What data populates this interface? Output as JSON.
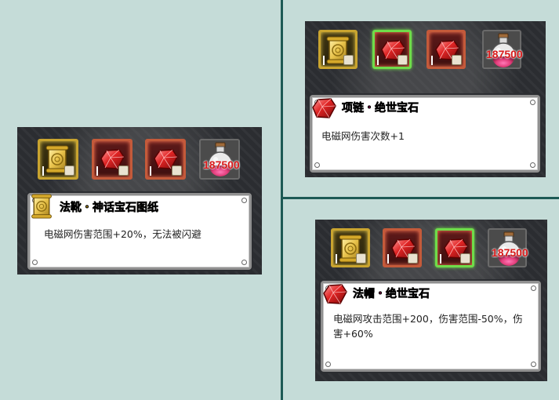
{
  "colors": {
    "background": "#c5dcd8",
    "divider": "#1d5a55",
    "title_gold": "#f2c418",
    "title_magenta": "#b01060",
    "count_red": "#d81a1a",
    "selected_border": "#6fdc4a"
  },
  "panels": [
    {
      "slots": [
        {
          "type": "scroll",
          "icon": "scroll-icon",
          "selected": false
        },
        {
          "type": "gem",
          "icon": "red-gem-icon",
          "selected": false
        },
        {
          "type": "gem",
          "icon": "red-gem-icon",
          "selected": false
        },
        {
          "type": "potion",
          "icon": "potion-icon",
          "count": "187500"
        }
      ],
      "tooltip": {
        "icon": "scroll-icon",
        "title": "法靴・神话宝石图纸",
        "description": "电磁网伤害范围+20%，无法被闪避"
      }
    },
    {
      "slots": [
        {
          "type": "scroll",
          "icon": "scroll-icon",
          "selected": false
        },
        {
          "type": "gem",
          "icon": "red-gem-icon",
          "selected": true
        },
        {
          "type": "gem",
          "icon": "red-gem-icon",
          "selected": false
        },
        {
          "type": "potion",
          "icon": "potion-icon",
          "count": "187500"
        }
      ],
      "tooltip": {
        "icon": "red-gem-icon",
        "title": "项链・绝世宝石",
        "description": "电磁网伤害次数+1"
      }
    },
    {
      "slots": [
        {
          "type": "scroll",
          "icon": "scroll-icon",
          "selected": false
        },
        {
          "type": "gem",
          "icon": "red-gem-icon",
          "selected": false
        },
        {
          "type": "gem",
          "icon": "red-gem-icon",
          "selected": true
        },
        {
          "type": "potion",
          "icon": "potion-icon",
          "count": "187500"
        }
      ],
      "tooltip": {
        "icon": "red-gem-icon",
        "title": "法帽・绝世宝石",
        "description": "电磁网攻击范围+200，伤害范围-50%，伤害+60%"
      }
    }
  ]
}
